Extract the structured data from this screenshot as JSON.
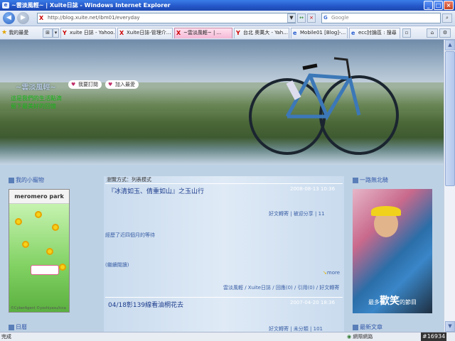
{
  "window": {
    "title": "~雲淡風輕~ | Xuite日誌 - Windows Internet Explorer"
  },
  "address": {
    "url": "http://blog.xuite.net/ibm01/everyday",
    "search_placeholder": "Google"
  },
  "favorites_label": "我的最愛",
  "tabs": [
    {
      "label": "xuite 日誌 - Yahoo..."
    },
    {
      "label": "Xuite日誌-管理介..."
    },
    {
      "label": "~雲淡風輕~ | ..."
    },
    {
      "label": "台北 奧萬大 - Yah..."
    },
    {
      "label": "Mobile01 [Blog]-..."
    },
    {
      "label": "ecc討論區 : 搜尋"
    }
  ],
  "banner": {
    "blog_title": "~雲淡風輕~",
    "description_line1": "這是我們的生活點滴",
    "description_line2": "留下最美好的回憶",
    "button_sub": "我要訂閱",
    "button_fav": "加入最愛"
  },
  "left": {
    "pet_heading": "我的小寵物",
    "widget_title": "meromero park",
    "widget_credit": "©CyberAgent ©yoshiyasu/icca",
    "calendar_heading": "日曆"
  },
  "center": {
    "view_mode": "瀏覽方式：列表模式",
    "post1": {
      "title": "『冰清如玉、倩重如山』之玉山行",
      "date": "2008-08-13 10:36",
      "meta": "好文轉寄 | 被迎分享 | 11",
      "excerpt": "經歷了近四個月的等待",
      "continue": "(繼續閱讀)",
      "more": "more",
      "footer": "雲淡風輕 / Xuite日誌 / 回應(0) / 引用(0) / 好文轉寄"
    },
    "post2": {
      "title": "04/18彰139線看油桐花去",
      "date": "2007-04-20 18:36",
      "meta": "好文轉寄 | 未分類 | 101"
    }
  },
  "right": {
    "heading": "一路無北騎",
    "photo_caption_small": "最多",
    "photo_caption_big": "歡笑",
    "photo_caption_end": "的節目",
    "latest_heading": "最新文章"
  },
  "status": {
    "text": "完成",
    "zone": "網際網路",
    "watermark": "#16934"
  }
}
